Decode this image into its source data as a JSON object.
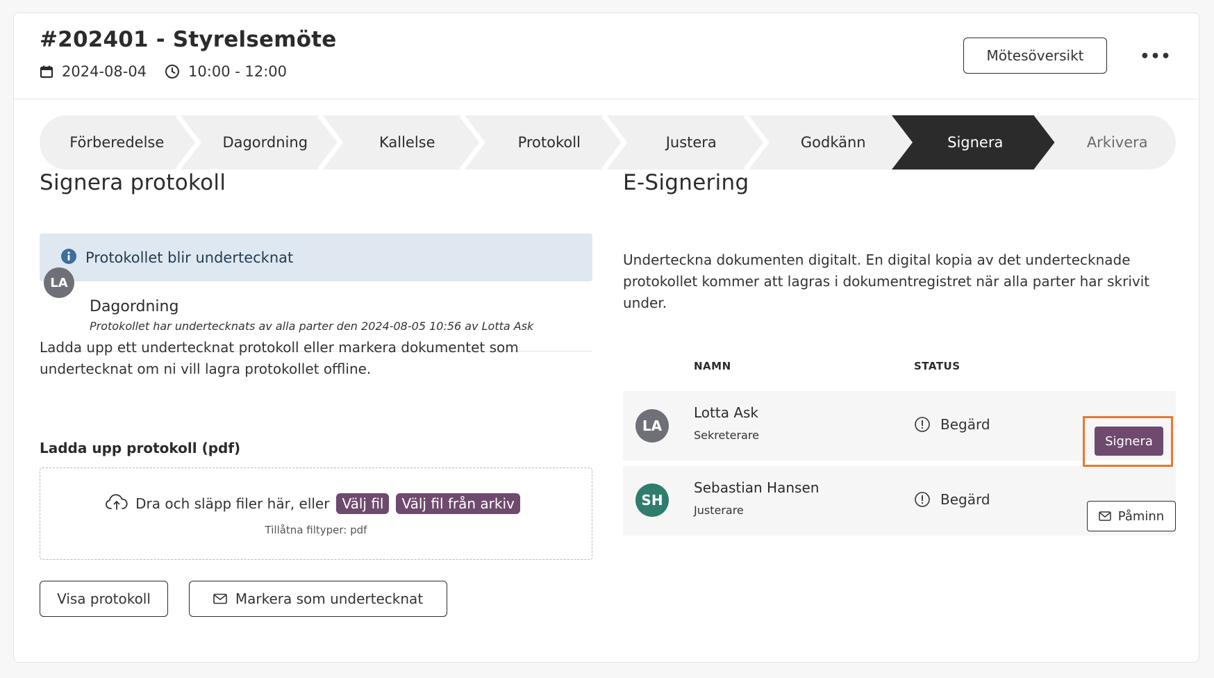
{
  "header": {
    "title": "#202401 - Styrelsemöte",
    "date": "2024-08-04",
    "time": "10:00 - 12:00",
    "overview_button": "Mötesöversikt",
    "more_button": "•••"
  },
  "stepper": {
    "active_index": 6,
    "steps": [
      "Förberedelse",
      "Dagordning",
      "Kallelse",
      "Protokoll",
      "Justera",
      "Godkänn",
      "Signera",
      "Arkivera"
    ]
  },
  "left": {
    "heading": "Signera protokoll",
    "info": "Protokollet blir undertecknat",
    "item": {
      "initials": "LA",
      "title": "Dagordning",
      "subtitle": "Protokollet har undertecknats av alla parter den 2024-08-05 10:56 av Lotta Ask"
    },
    "upload_text_line1": "Ladda upp ett undertecknat protokoll eller markera dokumentet som",
    "upload_text_line2": "undertecknat om ni vill lagra protokollet offline.",
    "upload_label": "Ladda upp protokoll (pdf)",
    "dropzone": {
      "text": "Dra och släpp filer här, eller",
      "choose_file": "Välj fil",
      "choose_archive": "Välj fil från arkiv",
      "allowed": "Tillåtna filtyper: pdf"
    },
    "show_button": "Visa protokoll",
    "mark_button": "Markera som undertecknat"
  },
  "right": {
    "heading": "E-Signering",
    "description_line1": "Underteckna dokumenten digitalt. En digital kopia av det undertecknade",
    "description_line2": "protokollet kommer att lagras i dokumentregistret när alla parter har skrivit",
    "description_line3": "under.",
    "columns": {
      "name": "NAMN",
      "status": "STATUS"
    },
    "signers": [
      {
        "initials": "LA",
        "name": "Lotta Ask",
        "role": "Sekreterare",
        "status": "Begärd",
        "action": "Signera"
      },
      {
        "initials": "SH",
        "name": "Sebastian Hansen",
        "role": "Justerare",
        "status": "Begärd",
        "action": "Påminn"
      }
    ]
  },
  "colors": {
    "primary": "#6e4a6e",
    "active_step": "#2b2b2b",
    "step_bg": "#f0f0f0",
    "info_bg": "#dfe8f0",
    "info_icon": "#3c6e9e",
    "avatar_la": "#6f6f77",
    "avatar_sh": "#2f7d6d",
    "highlight": "#e8782f"
  },
  "icons": {
    "date": "calendar-icon",
    "time": "clock-icon",
    "info": "info-icon",
    "upload": "cloud-upload-icon",
    "mark": "envelope-icon",
    "status": "exclamation-circle-icon",
    "remind": "envelope-icon"
  }
}
